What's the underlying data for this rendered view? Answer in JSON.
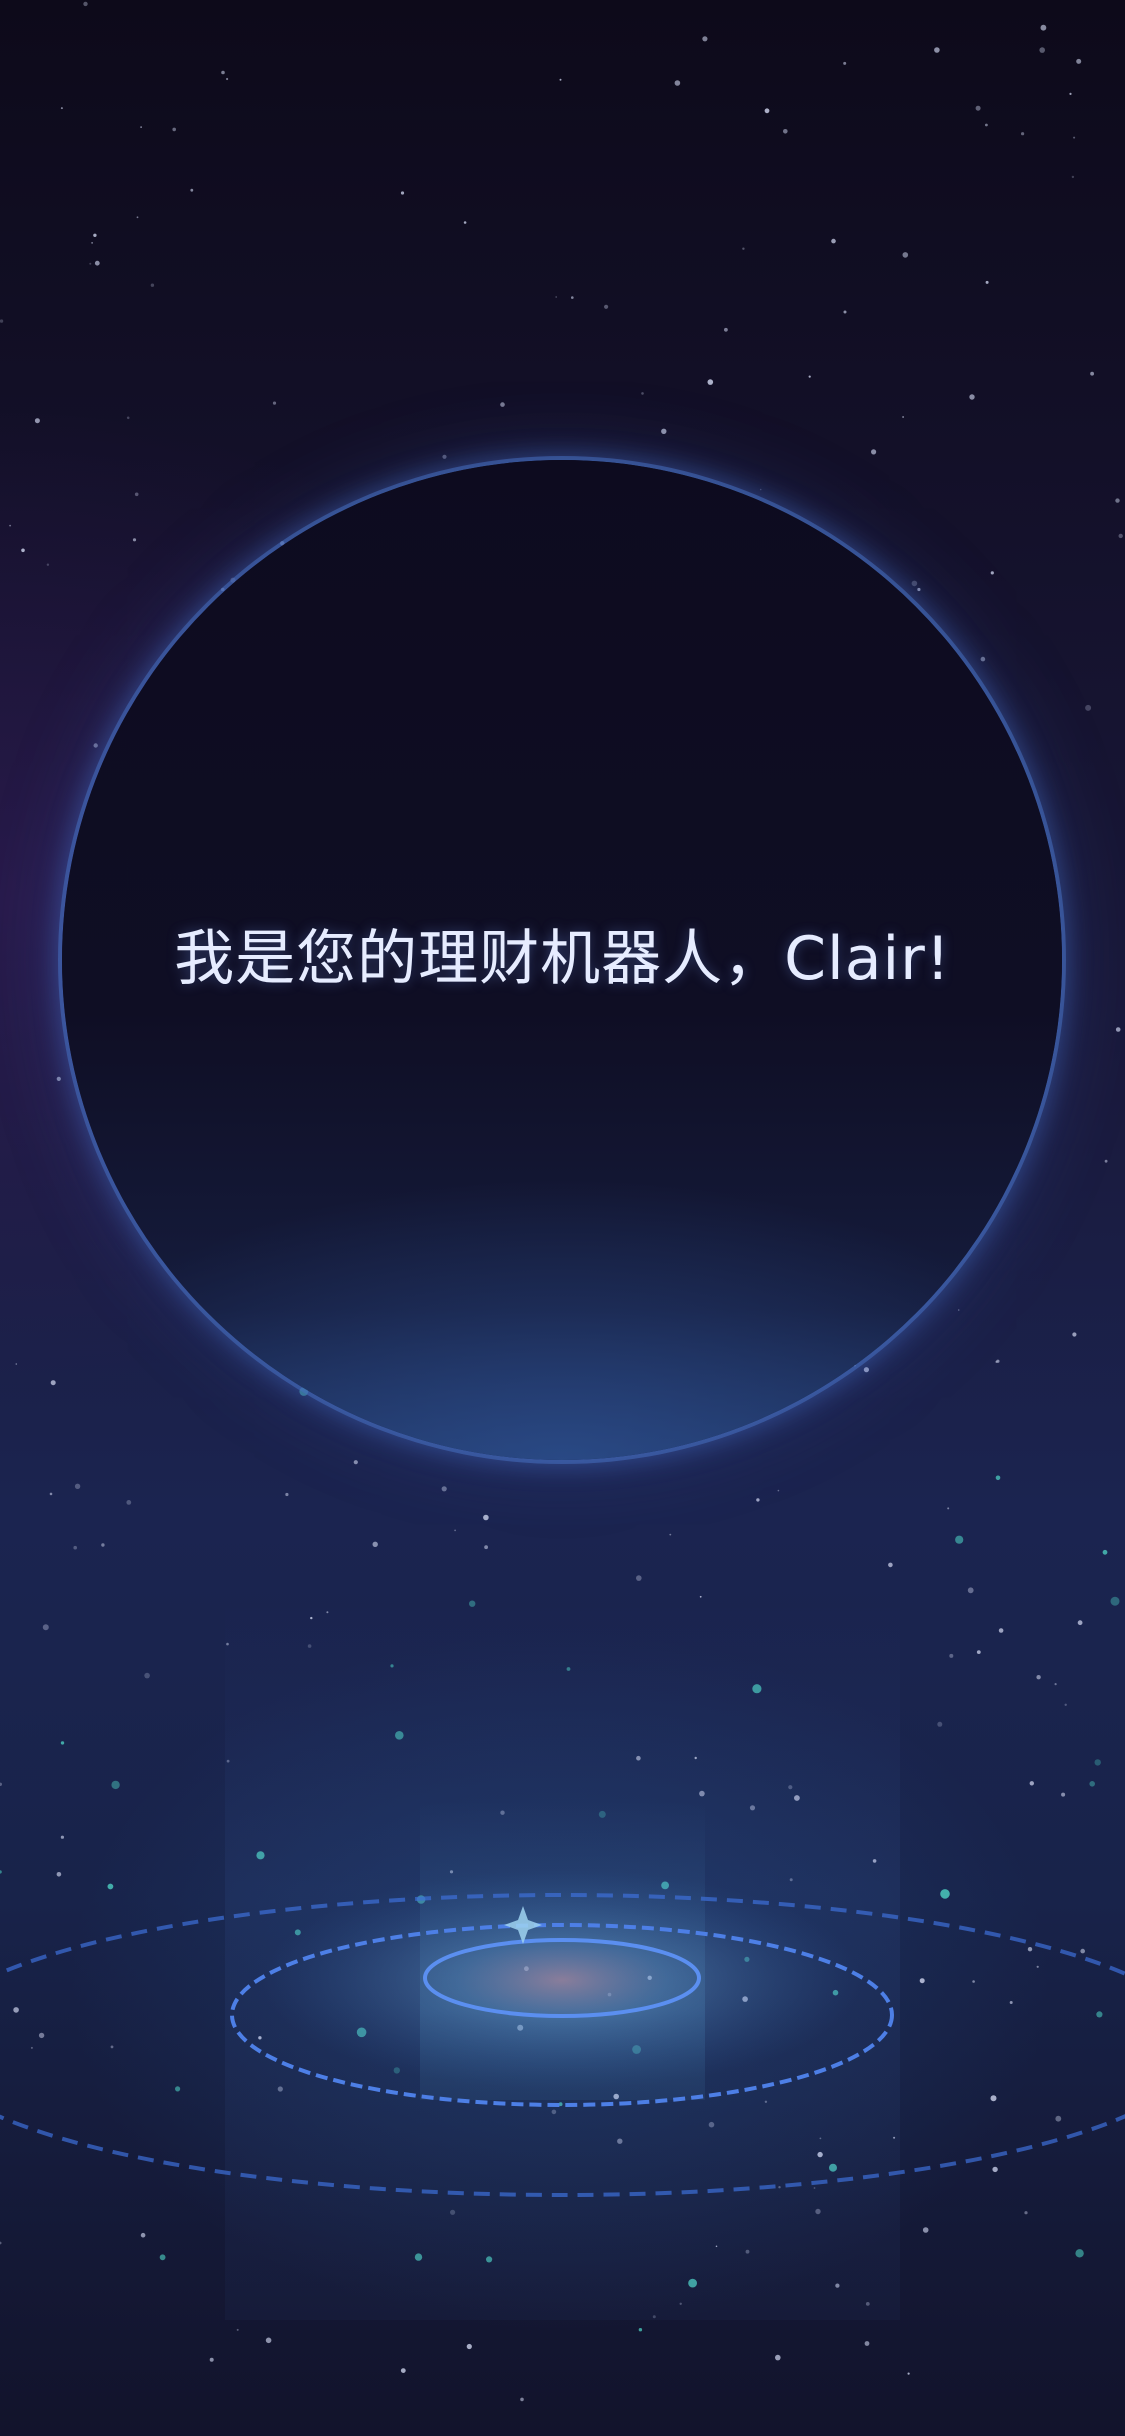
{
  "greeting": {
    "text": "我是您的理财机器人，Clair!"
  },
  "colors": {
    "background_top": "#0d0a1a",
    "background_mid": "#1b2450",
    "orb_rim": "#4a6ec0",
    "text": "#e6ecff",
    "ring": "#3d6fd8"
  },
  "icons": {
    "sparkle": "four-point-star",
    "platform": "holographic-rings"
  }
}
